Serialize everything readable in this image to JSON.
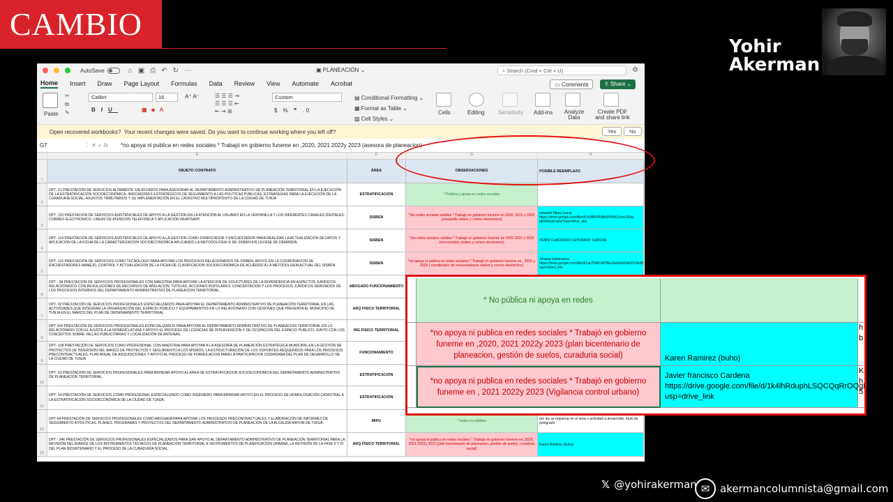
{
  "brand": {
    "name": "CAMBIO"
  },
  "author": {
    "first_name": "Yohir",
    "last_name": "Akerman"
  },
  "footer": {
    "handle": "@yohirakerman",
    "email": "akermancolumnista@gmail.com"
  },
  "excel": {
    "autosave_label": "AutoSave",
    "file_name": "PLANEACIÓN",
    "search_placeholder": "Search (Cmd + Ctrl + U)",
    "menu": [
      "Home",
      "Insert",
      "Draw",
      "Page Layout",
      "Formulas",
      "Data",
      "Review",
      "View",
      "Automate",
      "Acrobat"
    ],
    "comments_label": "Comments",
    "share_label": "Share",
    "ribbon": {
      "paste": "Paste",
      "font_name": "Calibri",
      "font_size": "16",
      "number_format": "Custom",
      "conditional_formatting": "Conditional Formatting",
      "format_as_table": "Format as Table",
      "cell_styles": "Cell Styles",
      "cells": "Cells",
      "editing": "Editing",
      "sensitivity": "Sensitivity",
      "addins": "Add-ins",
      "analyze_data": "Analyze Data",
      "create_pdf": "Create PDF and share link"
    },
    "notice": {
      "title": "Open recovered workbooks?",
      "message": "Your recent changes were saved. Do you want to continue working where you left off?",
      "yes": "Yes",
      "no": "No"
    },
    "name_box": "G7",
    "formula": "*no apoya ni publica en redes sociales * Trabajó en gobierno funeme en ,2020, 2021 2022y 2023 (asesora  de planeacion)"
  },
  "sheet": {
    "columns": [
      "E",
      "F",
      "G",
      "H"
    ],
    "headers": {
      "objeto": "OBJETO CONTRATO",
      "area": "ÁREA",
      "obs": "OBSERVACIONES",
      "rep": "POSIBLE REEMPLAZO"
    },
    "rows": [
      {
        "n": "2",
        "objeto": "DPT- 61 PRESTACIÓN DE SERVICIOS ALTAMENTE CALIFICADOS PARA ASESORAR AL DEPARTAMENTO ADMINISTRATIVO DE PLANEACIÓN TERRITORIAL EN LA EJECUCIÓN DE LA ESTRATIFICACIÓN SOCIOECONÓMICA, INDICADORES ESTRATÉGICOS DE SEGUIMIENTO A LAS POLÍTICAS PÚBLICAS, ESTRATEGIAS PARA LA EJECUCIÓN DE LA CURADURÍA SOCIAL, ASUNTOS TRIBUTARIOS Y SU IMPLEMENTACIÓN EN EL CATASTRO MULTIPROPÓSITO DE LA CIUDAD DE TUNJA",
        "area": "ESTRATIFICACIÓN",
        "obs": "* Publica y apoya en redes sociales",
        "rep": ""
      },
      {
        "n": "3",
        "objeto": "DPT- 110 PRESTACION DE SERVICIOS ASISTENCIALES DE APOYO A LA GESTION EN LA ATENCIÓN AL USUARIO EN LA VENTANILLA Y LOS DIFERENTES CANALES DIGITALES: CORREO ELECTRONICO, LINEAS DE ATENCION TELEFONICA Y APLICACIÓN WHATSAPP.",
        "area": "SISBEN",
        "obs": "*Sin redes sociales visibles * Trabajó en gobierno funeme en 2020, 2021 y 2023 (ventanilla sisben y correo electronico)",
        "rep": "eduardo Mesa (sara) https://drive.google.com/file/d/14JB4VRWbfZPMXUJcxUSNq-qhN46ute/view?usp=drive_link"
      },
      {
        "n": "4",
        "objeto": "DPT- 114 PRESTACION DE SERVICIOS ASISTENCIALES DE APOYO A LA GESTION COMO ZONIFICADOR Y ENCUESTADOR PARA REALIZAR LA ACTUALIZACION DE DATOS Y APLICACION DE LA FICHA DE LA CARACTERIZACION SOCIOECONOMICA APLICANDO LA METODOLOGIA IV DE SISBEN EN LA FASE DE DEMANDA.",
        "area": "SISBEN",
        "obs": "*Sin redes sociales visibles * Trabajó en gobierno funeme en 2020 2022 y 2023 (encuestador  sisben y correo electronico)",
        "rep": "YENNI CUADRADO (GIOVANNY GARCIA)"
      },
      {
        "n": "5",
        "objeto": "DPT- 115 PRESTACIÓN DE SERVICIOS COMO TECNÓLOGO PARA APOYAR LOS PROCESOS RELACIONADOS DE SISBEN, APOYO EN LA COORDINACION DE ENCUESTADORES MANEJO, CONTROL Y ACTUALIZACION DE LA FICHA DE CLASIFICACION SOCIOECONOMICA DE ACUERDO A LA METODOLOGIA ACTUAL DEL SISBEN",
        "area": "SISBEN",
        "obs": "*no apoya ni publica en redes sociales * Trabajó en gobierno funeme en , 2021 y 2023 ( coordinador de encuestadores sisben y correo electronico)",
        "rep": "Johana Salamanca https://drive.google.com/file/d/1abThRhVATifEoSwNvk92dtXVZ4o8U/view?usp=share_link"
      },
      {
        "n": "6",
        "objeto": "DPT - 98 PRESTACION DE SERVICIOS PROFESIONALES CON MAESTRIA PARA APOYAR LA ATENCION DE SOLICITUDES DE LA DEPENDENCIA EN ASPECTOS JURIDICOS RELACIONADOS CON RESOLUCIONES DE RECURSOS DE APELACION, TUTELAS, ACCIONES POPULARES, CONCERTACION Y LOS PROCESOS JURIDICOS DERIVADOS DE LOS PROCESOS INTERNOS DEL DEPARTAMENTO ADMINISTRATIVO DE PLANEACION TERRITORIAL.",
        "area": "ABOGADO FUNCIONAMIENTO",
        "obs": "",
        "rep": ""
      },
      {
        "n": "7",
        "objeto": "DPT- 02 PRESTACIÓN DE SERVICIOS PROFESIONALES ESPECIALIZADOS PARA APOYAR EL DEPARTAMENTO ADMINISTRATIVO DE PLANEACIÓN TERRITORIAL EN LAS ACTIVIDADES QUE INTEGRAN LA ORGANIZACIÓN DEL ESPACIO PÚBLICO Y EQUIPAMIENTOS EN LO RELACIONADO CON CESIONES QUE PRESENTA EL MUNICIPIO DE TUNJA EN EL MARCO DEL PLAN DE ORDENAMIENTO TERRITORIAL",
        "area": "ARQ FISICO TERRITORIAL",
        "obs": "",
        "rep": ""
      },
      {
        "n": "8",
        "objeto": "DPT-104 PRESTACIÓN DE SERVICIOS PROFESIONALES ESPECIALIZADOS PARA APOYAR AL DEPARTAMENTO ADMINISTRATIVO DE PLANEACION TERRITORIAL EN LO RELACIONADO CON EL AJUSTE A LA NOMENCLATURA Y APOYO EL PROCESO DE LICENCIAS DE INTERVENCION Y DE OCUPACION DEL ESPACIO PUBLICO, JUNTO CON LOS CONCEPTOS SOBRE VALLAS PUBLICITARIAS Y LOCALIZACIÓN DE ANTENAS.",
        "area": "ING FISICO TERRITORIAL",
        "obs": "",
        "rep": ""
      },
      {
        "n": "9",
        "objeto": "DPT- 108 PRESTACIÓN DE SERVICIOS COMO PROFESIONAL CON MAESTRIA PARA APOYAR A LA ASESORÍA DE PLANEACIÓN ESTRATÉGICA MUNICIPAL EN LA GESTIÓN DE PROYECTOS DE INVERSIÓN DEL BANCO DE PROYECTOS Y SEGUIMIENTO A LOS MISMOS, LA ESTRUCTURACIÓN DE LOS SOPORTES REQUERIDOS PARA LOS PROCESOS PRECONTRACTUALES, PLAN ANUAL DE ADQUISICIONES Y APOYO AL PROCESO DE FORMULACION PARA LA PARTICIPACION CIUDADANA DEL PLAN DE DESARROLLO DE LA CIUDAD DE TUNJA",
        "area": "FUNCIONAMIENTO",
        "obs": "",
        "rep": ""
      },
      {
        "n": "10",
        "objeto": "DPT- 53 PRESTACION DE SERVICIOS PROFESIONALES PARA BRINDAR APOYO AL AREA DE ESTRATIFICACION SOCIOECONOMICA DEL DEPARTAMENTO ADMINISTRATIVO DE PLANEACION TERRITORIAL.",
        "area": "ESTRATIFICACIÓN",
        "obs": "",
        "rep": ""
      },
      {
        "n": "11",
        "objeto": "DPT- 54 PRESTACIÓN DE SERVICIOS COMO PROFESIONAL ESPECIALIZADO COMO INGENIERO PARA BRINDAR APOYO EN EL PROCESO DE HOMOLOGACIÓN CATASTRAL A LA ESTRATIFICACIÓN SOCIOECONÓMICA DE LA CIUDAD DE TUNJA.",
        "area": "ESTRATIFICACIÓN",
        "obs": "",
        "rep": ""
      },
      {
        "n": "12",
        "objeto": "DPT-94 PRESTACIÓN DE SERVICIOS PROFESIONALES COMO ABOGADA PARA APOYAR LOS PROCESOS PRECONTRACTUALES Y ELABORACIÓN DE INFORMES DE SEGUIMIENTO A POLÍTICAS, PLANES, PROGRAMAS Y PROYECTOS DEL DEPARTAMENTO ADMINISTRATIVO DE PLANEACIÓN DE LA ALCALDÍA MAYOR DE TUNJA.",
        "area": "MIPG",
        "obs": "* redes no visibles",
        "rep": "por ley se requiera) en el área o actividad a desarrollar, título de postgrado."
      },
      {
        "n": "13",
        "objeto": "DPT - 246 PRESTACIÓN DE SERVICIOS PROFESIONALES ESPECIALIZADOS PARA DAR APOYO AL DEPARTAMENTO ADMINISTRATIVO DE PLANEACIÓN TERRITORIAL PARA LA REVISIÓN DEL AVANCE DE LOS INSTRUMENTOS TÉCNICOS DE PLANEACIÓN TERRITORIAL E INSTRUMENTOS DE PLANIFICACIÓN URBANA, LA REVISIÓN DE LA FASE II Y III DEL PLAN BICENTENARIO Y EL PROCESO DE LA CURADURÍA SOCIAL.",
        "area": "ARQ FÍSICO TERRITORIAL",
        "obs": "*no apoya ni publica en redes sociales * Trabajó en gobierno funeme en ,2020, 2021 2022y 2023 (plan bicentenario de planeacion, gestión de suelos, curaduria social)",
        "rep": "Karen Ramirez (buho)"
      }
    ]
  },
  "zoom": {
    "rows": [
      {
        "obs": "* No pública ni apoya en redes",
        "rep": "",
        "tail": ""
      },
      {
        "obs": "*no apoya ni publica en redes sociales * Trabajó en gobierno funeme en ,2020, 2021 2022y 2023 (plan bicentenario de planeacion, gestión de suelos, curaduria social)",
        "rep": "Karen Ramirez (buho)",
        "tail": "h b"
      },
      {
        "obs": "*no apoya ni publica en redes sociales * Trabajó en gobierno funeme en , 2021 2022y 2023 (Vigilancia control urbano)",
        "rep": "Javier francisco Cardena https://drive.google.com/file/d/1k4lhRduphLSQCQqRrOQgDjcpyka1O0nz/view?usp=drive_link",
        "tail": "K h 5"
      }
    ]
  },
  "colors": {
    "brand_red": "#d8232a",
    "excel_green": "#1f7145",
    "ok_green": "#c6efce",
    "bad_pink": "#ffc7ce",
    "cyan": "#00ffff",
    "highlight_red": "#e01010"
  }
}
